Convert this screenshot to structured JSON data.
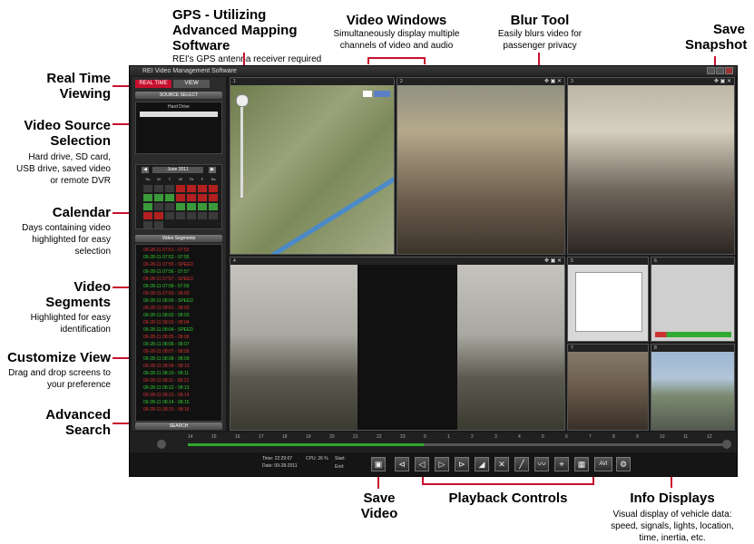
{
  "app": {
    "title": "REI Video Management Software",
    "real_time_tab": "REAL TIME",
    "review_tab": "VIEW",
    "source_select": "SOURCE SELECT",
    "source_item": "Hard Drive",
    "calendar_month": "June 2011",
    "calendar_days": [
      "Su",
      "M",
      "T",
      "W",
      "Th",
      "F",
      "Sa"
    ],
    "segments_header": "Video Segments",
    "segments": [
      "09-28-11 07:51 - 07:52",
      "09-28-11 07:52 - 07:55",
      "09-28-11 07:55 - SPEED",
      "09-28-11 07:56 - 07:57",
      "09-28-11 07:57 - SPEED",
      "09-28-11 07:58 - 07:59",
      "09-28-11 07:59 - 08:00",
      "09-28-11 08:00 - SPEED",
      "09-28-11 08:01 - 08:02",
      "09-28-11 08:02 - 08:03",
      "09-28-11 08:03 - 08:04",
      "09-28-11 08:04 - SPEED",
      "09-28-11 08:05 - 08:06",
      "09-28-11 08:06 - 08:07",
      "09-28-11 08:07 - 08:08",
      "09-28-11 08:08 - 08:09",
      "09-28-11 08:09 - 08:10",
      "09-28-11 08:10 - 08:11",
      "09-28-11 08:11 - 08:12",
      "09-28-11 08:12 - 08:13",
      "09-28-11 08:13 - 08:14",
      "09-28-11 08:14 - 08:15",
      "09-28-11 08:15 - 08:16"
    ],
    "search_button": "SEARCH",
    "cpu_label": "CPU: 26 %",
    "time_label": "Time: 22:29:07",
    "date_label": "Date: 09-28-2011",
    "start_label": "Start:",
    "end_label": "End:",
    "timeline_ticks": [
      "14",
      "15",
      "16",
      "17",
      "18",
      "19",
      "20",
      "21",
      "22",
      "23",
      "0",
      "1",
      "2",
      "3",
      "4",
      "5",
      "6",
      "7",
      "8",
      "9",
      "10",
      "11",
      "12"
    ],
    "avi_label": "AVI"
  },
  "callouts": {
    "gps_title": "GPS - Utilizing Advanced Mapping Software",
    "gps_desc": "REI's GPS antenna receiver required",
    "video_windows_title": "Video Windows",
    "video_windows_desc": "Simultaneously display multiple channels of video and audio",
    "blur_title": "Blur Tool",
    "blur_desc": "Easily blurs video for passenger privacy",
    "save_snapshot_title": "Save Snapshot",
    "real_time_title": "Real Time Viewing",
    "video_source_title": "Video Source Selection",
    "video_source_desc": "Hard drive, SD card, USB drive, saved video or remote DVR",
    "calendar_title": "Calendar",
    "calendar_desc": "Days containing video highlighted for easy selection",
    "segments_title": "Video Segments",
    "segments_desc": "Highlighted for easy identification",
    "customize_title": "Customize View",
    "customize_desc": "Drag and drop screens to your preference",
    "advanced_title": "Advanced Search",
    "save_video_title": "Save Video",
    "playback_title": "Playback Controls",
    "info_title": "Info Displays",
    "info_desc": "Visual display of vehicle data: speed, signals, lights, location, time, inertia, etc."
  },
  "colors": {
    "accent": "#c8102e",
    "green_day": "#3a9a3a",
    "red_day": "#b32020"
  }
}
